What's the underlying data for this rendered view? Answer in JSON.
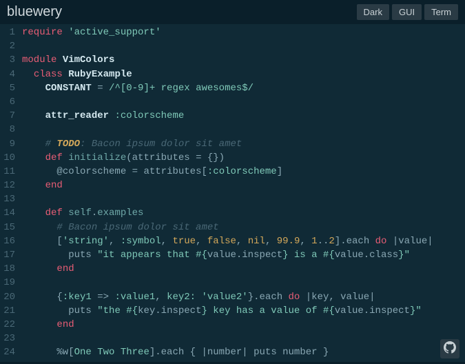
{
  "header": {
    "title": "bluewery",
    "buttons": [
      {
        "label": "Dark"
      },
      {
        "label": "GUI"
      },
      {
        "label": "Term"
      }
    ]
  },
  "code": {
    "lines": [
      [
        {
          "c": "kw",
          "t": "require"
        },
        {
          "c": "punct",
          "t": " "
        },
        {
          "c": "str",
          "t": "'active_support'"
        }
      ],
      [],
      [
        {
          "c": "kw",
          "t": "module"
        },
        {
          "c": "punct",
          "t": " "
        },
        {
          "c": "const",
          "t": "VimColors"
        }
      ],
      [
        {
          "c": "punct",
          "t": "  "
        },
        {
          "c": "kw",
          "t": "class"
        },
        {
          "c": "punct",
          "t": " "
        },
        {
          "c": "const",
          "t": "RubyExample"
        }
      ],
      [
        {
          "c": "punct",
          "t": "    "
        },
        {
          "c": "const",
          "t": "CONSTANT"
        },
        {
          "c": "op",
          "t": " = "
        },
        {
          "c": "regex",
          "t": "/^[0-9]+ regex awesomes$/"
        }
      ],
      [],
      [
        {
          "c": "punct",
          "t": "    "
        },
        {
          "c": "attr",
          "t": "attr_reader"
        },
        {
          "c": "punct",
          "t": " "
        },
        {
          "c": "sym",
          "t": ":colorscheme"
        }
      ],
      [],
      [
        {
          "c": "punct",
          "t": "    "
        },
        {
          "c": "comment",
          "t": "# "
        },
        {
          "c": "todo",
          "t": "TODO"
        },
        {
          "c": "comment",
          "t": ": Bacon ipsum dolor sit amet"
        }
      ],
      [
        {
          "c": "punct",
          "t": "    "
        },
        {
          "c": "kw",
          "t": "def"
        },
        {
          "c": "punct",
          "t": " "
        },
        {
          "c": "fn",
          "t": "initialize"
        },
        {
          "c": "punct",
          "t": "(attributes = {})"
        }
      ],
      [
        {
          "c": "punct",
          "t": "      "
        },
        {
          "c": "ivar",
          "t": "@colorscheme"
        },
        {
          "c": "op",
          "t": " = "
        },
        {
          "c": "ident",
          "t": "attributes"
        },
        {
          "c": "punct",
          "t": "["
        },
        {
          "c": "sym",
          "t": ":colorscheme"
        },
        {
          "c": "punct",
          "t": "]"
        }
      ],
      [
        {
          "c": "punct",
          "t": "    "
        },
        {
          "c": "kw",
          "t": "end"
        }
      ],
      [],
      [
        {
          "c": "punct",
          "t": "    "
        },
        {
          "c": "kw",
          "t": "def"
        },
        {
          "c": "punct",
          "t": " "
        },
        {
          "c": "fn",
          "t": "self"
        },
        {
          "c": "punct",
          "t": "."
        },
        {
          "c": "fn",
          "t": "examples"
        }
      ],
      [
        {
          "c": "punct",
          "t": "      "
        },
        {
          "c": "comment",
          "t": "# Bacon ipsum dolor sit amet"
        }
      ],
      [
        {
          "c": "punct",
          "t": "      ["
        },
        {
          "c": "str",
          "t": "'string'"
        },
        {
          "c": "punct",
          "t": ", "
        },
        {
          "c": "sym",
          "t": ":symbol"
        },
        {
          "c": "punct",
          "t": ", "
        },
        {
          "c": "bool",
          "t": "true"
        },
        {
          "c": "punct",
          "t": ", "
        },
        {
          "c": "bool",
          "t": "false"
        },
        {
          "c": "punct",
          "t": ", "
        },
        {
          "c": "nil",
          "t": "nil"
        },
        {
          "c": "punct",
          "t": ", "
        },
        {
          "c": "num",
          "t": "99.9"
        },
        {
          "c": "punct",
          "t": ", "
        },
        {
          "c": "num",
          "t": "1"
        },
        {
          "c": "punct",
          "t": ".."
        },
        {
          "c": "num",
          "t": "2"
        },
        {
          "c": "punct",
          "t": "]."
        },
        {
          "c": "ident",
          "t": "each"
        },
        {
          "c": "punct",
          "t": " "
        },
        {
          "c": "kw",
          "t": "do"
        },
        {
          "c": "punct",
          "t": " |value|"
        }
      ],
      [
        {
          "c": "punct",
          "t": "        "
        },
        {
          "c": "ident",
          "t": "puts"
        },
        {
          "c": "punct",
          "t": " "
        },
        {
          "c": "str",
          "t": "\"it appears that "
        },
        {
          "c": "interp",
          "t": "#{"
        },
        {
          "c": "ident",
          "t": "value.inspect"
        },
        {
          "c": "interp",
          "t": "}"
        },
        {
          "c": "str",
          "t": " is a "
        },
        {
          "c": "interp",
          "t": "#{"
        },
        {
          "c": "ident",
          "t": "value.class"
        },
        {
          "c": "interp",
          "t": "}"
        },
        {
          "c": "str",
          "t": "\""
        }
      ],
      [
        {
          "c": "punct",
          "t": "      "
        },
        {
          "c": "kw",
          "t": "end"
        }
      ],
      [],
      [
        {
          "c": "punct",
          "t": "      {"
        },
        {
          "c": "sym",
          "t": ":key1"
        },
        {
          "c": "op",
          "t": " => "
        },
        {
          "c": "sym",
          "t": ":value1"
        },
        {
          "c": "punct",
          "t": ", "
        },
        {
          "c": "sym",
          "t": "key2:"
        },
        {
          "c": "punct",
          "t": " "
        },
        {
          "c": "str",
          "t": "'value2'"
        },
        {
          "c": "punct",
          "t": "}."
        },
        {
          "c": "ident",
          "t": "each"
        },
        {
          "c": "punct",
          "t": " "
        },
        {
          "c": "kw",
          "t": "do"
        },
        {
          "c": "punct",
          "t": " |key, value|"
        }
      ],
      [
        {
          "c": "punct",
          "t": "        "
        },
        {
          "c": "ident",
          "t": "puts"
        },
        {
          "c": "punct",
          "t": " "
        },
        {
          "c": "str",
          "t": "\"the "
        },
        {
          "c": "interp",
          "t": "#{"
        },
        {
          "c": "ident",
          "t": "key.inspect"
        },
        {
          "c": "interp",
          "t": "}"
        },
        {
          "c": "str",
          "t": " key has a value of "
        },
        {
          "c": "interp",
          "t": "#{"
        },
        {
          "c": "ident",
          "t": "value.inspect"
        },
        {
          "c": "interp",
          "t": "}"
        },
        {
          "c": "str",
          "t": "\""
        }
      ],
      [
        {
          "c": "punct",
          "t": "      "
        },
        {
          "c": "kw",
          "t": "end"
        }
      ],
      [],
      [
        {
          "c": "punct",
          "t": "      %w["
        },
        {
          "c": "str",
          "t": "One Two Three"
        },
        {
          "c": "punct",
          "t": "]."
        },
        {
          "c": "ident",
          "t": "each"
        },
        {
          "c": "punct",
          "t": " { |"
        },
        {
          "c": "ident",
          "t": "number"
        },
        {
          "c": "punct",
          "t": "| "
        },
        {
          "c": "ident",
          "t": "puts"
        },
        {
          "c": "punct",
          "t": " number }"
        }
      ]
    ]
  }
}
